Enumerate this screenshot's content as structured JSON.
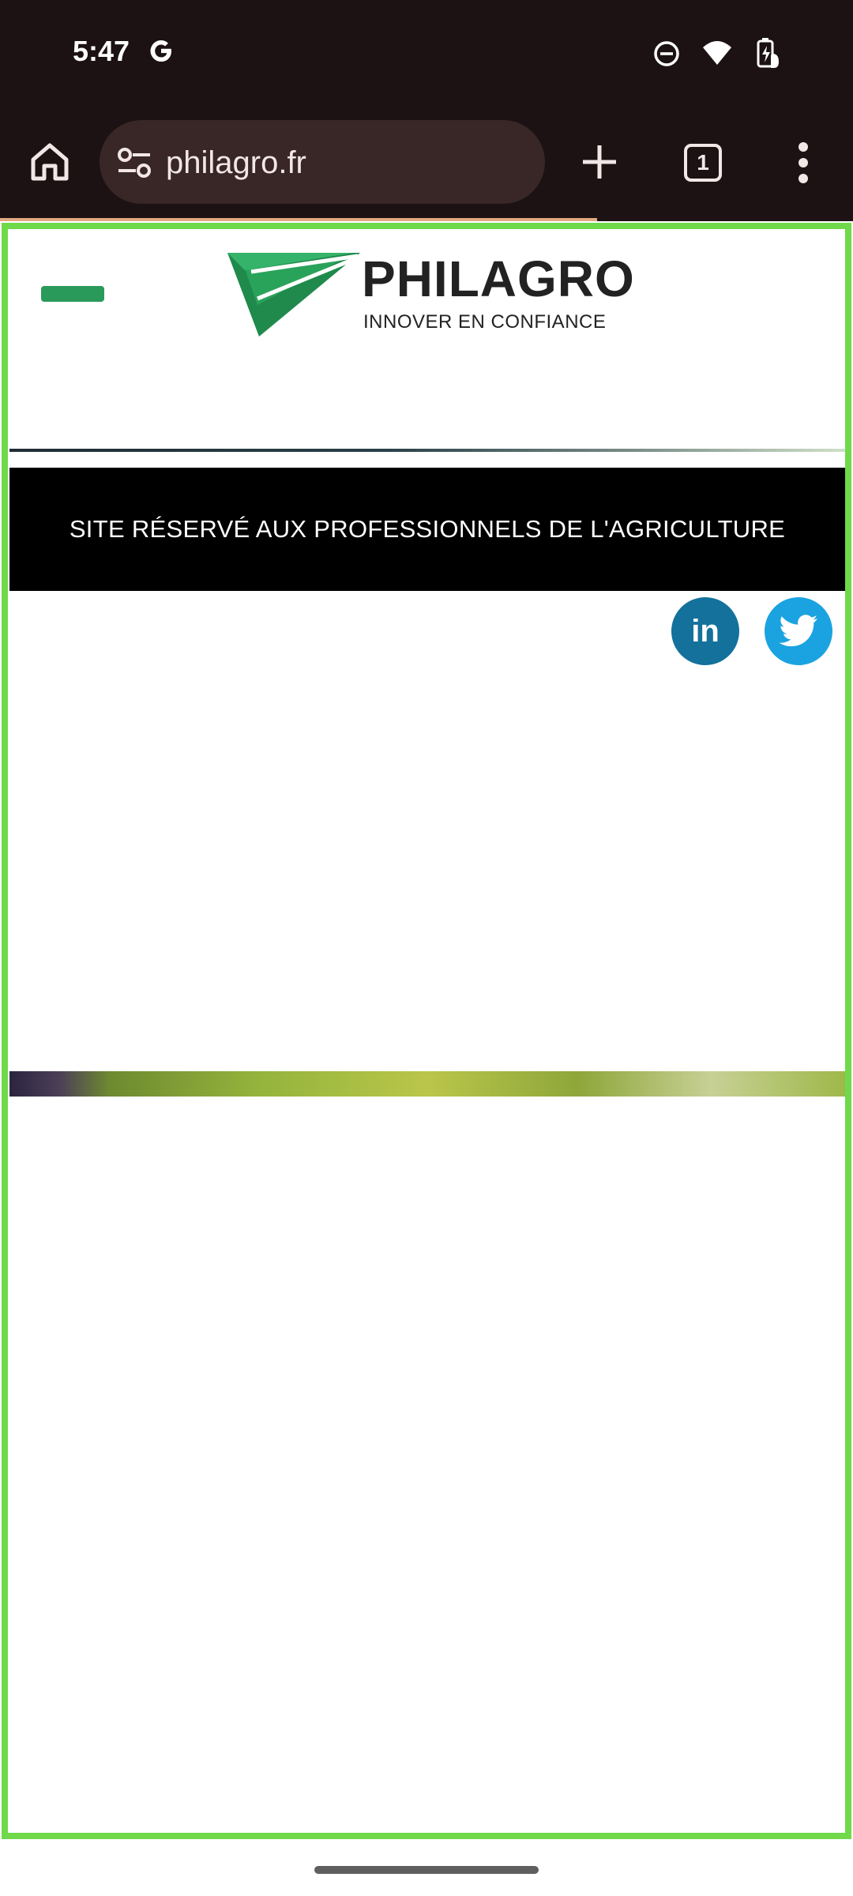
{
  "status_bar": {
    "time": "5:47",
    "icons": [
      "google-g-icon",
      "do-not-disturb-icon",
      "wifi-icon",
      "battery-charging-icon"
    ]
  },
  "browser": {
    "url": "philagro.fr",
    "tab_count": "1",
    "icons": [
      "home-icon",
      "site-settings-icon",
      "plus-icon",
      "more-vert-icon"
    ]
  },
  "page": {
    "logo": {
      "name": "PHILAGRO",
      "tagline": "INNOVER EN CONFIANCE"
    },
    "notice": "SITE RÉSERVÉ AUX PROFESSIONNELS DE L'AGRICULTURE",
    "social": {
      "linkedin_label": "in"
    }
  },
  "colors": {
    "accent_green": "#2a9a5a",
    "highlight_frame": "#6fd94a",
    "notice_bg": "#000000",
    "linkedin": "#13719c",
    "twitter": "#1aa3e0"
  }
}
